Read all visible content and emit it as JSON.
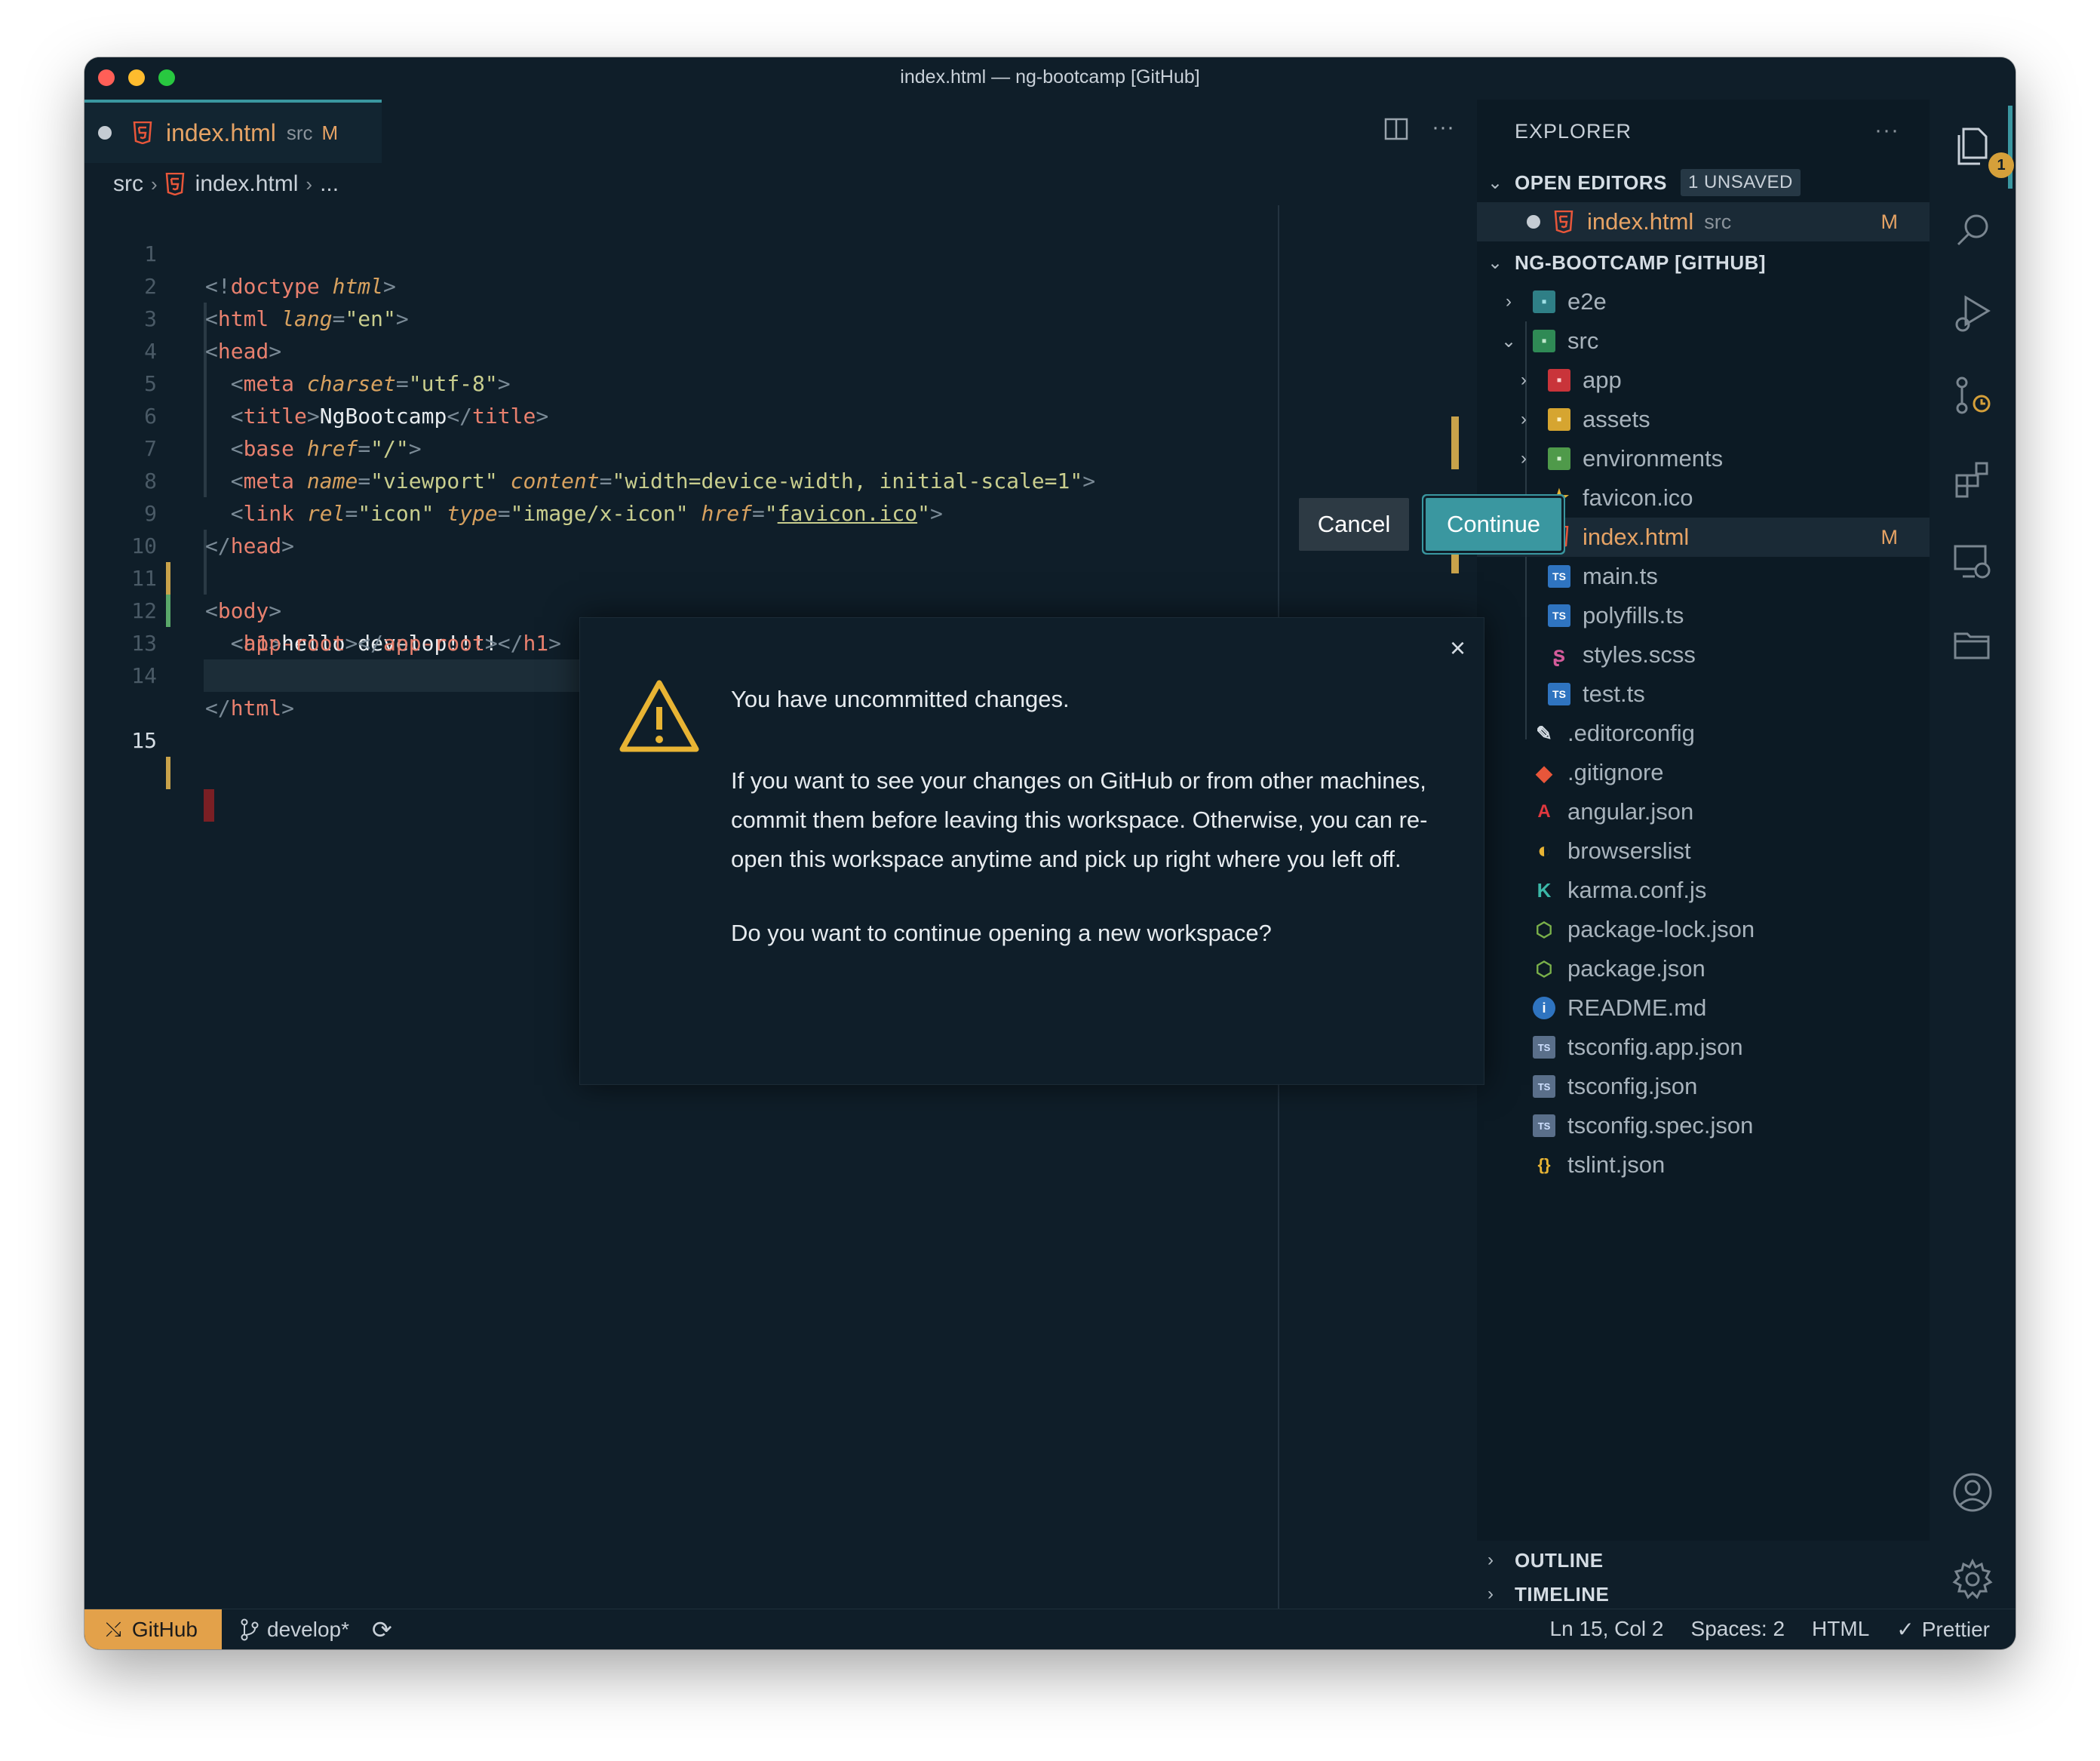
{
  "window": {
    "title": "index.html — ng-bootcamp [GitHub]"
  },
  "tab": {
    "name": "index.html",
    "path": "src",
    "status": "M"
  },
  "breadcrumb": {
    "root": "src",
    "file": "index.html",
    "more": "..."
  },
  "code": {
    "line_numbers": [
      "1",
      "2",
      "3",
      "4",
      "5",
      "6",
      "7",
      "8",
      "9",
      "10",
      "11",
      "12",
      "13",
      "14",
      "15"
    ],
    "active_line": "15"
  },
  "sidebar": {
    "header": "EXPLORER",
    "open_editors": {
      "label": "OPEN EDITORS",
      "badge": "1 UNSAVED",
      "items": [
        {
          "name": "index.html",
          "path": "src",
          "status": "M"
        }
      ]
    },
    "workspace": {
      "label": "NG-BOOTCAMP [GITHUB]",
      "items": [
        {
          "name": "e2e",
          "kind": "folder",
          "icon": "e2e-folder-icon"
        },
        {
          "name": "src",
          "kind": "folder-open",
          "icon": "src-folder-icon"
        },
        {
          "name": "app",
          "kind": "folder",
          "icon": "app-folder-icon"
        },
        {
          "name": "assets",
          "kind": "folder",
          "icon": "assets-folder-icon"
        },
        {
          "name": "environments",
          "kind": "folder",
          "icon": "environments-folder-icon"
        },
        {
          "name": "favicon.ico",
          "kind": "file",
          "icon": "star-icon"
        },
        {
          "name": "index.html",
          "kind": "file",
          "icon": "html5-icon",
          "status": "M"
        },
        {
          "name": "main.ts",
          "kind": "file",
          "icon": "typescript-icon"
        },
        {
          "name": "polyfills.ts",
          "kind": "file",
          "icon": "typescript-icon"
        },
        {
          "name": "styles.scss",
          "kind": "file",
          "icon": "sass-icon"
        },
        {
          "name": "test.ts",
          "kind": "file",
          "icon": "typescript-icon"
        },
        {
          "name": ".editorconfig",
          "kind": "file",
          "icon": "editorconfig-icon"
        },
        {
          "name": ".gitignore",
          "kind": "file",
          "icon": "git-icon"
        },
        {
          "name": "angular.json",
          "kind": "file",
          "icon": "angular-icon"
        },
        {
          "name": "browserslist",
          "kind": "file",
          "icon": "browserslist-icon"
        },
        {
          "name": "karma.conf.js",
          "kind": "file",
          "icon": "karma-icon"
        },
        {
          "name": "package-lock.json",
          "kind": "file",
          "icon": "nodejs-icon"
        },
        {
          "name": "package.json",
          "kind": "file",
          "icon": "nodejs-icon"
        },
        {
          "name": "README.md",
          "kind": "file",
          "icon": "info-icon"
        },
        {
          "name": "tsconfig.app.json",
          "kind": "file",
          "icon": "tsconfig-icon"
        },
        {
          "name": "tsconfig.json",
          "kind": "file",
          "icon": "tsconfig-icon"
        },
        {
          "name": "tsconfig.spec.json",
          "kind": "file",
          "icon": "tsconfig-icon"
        },
        {
          "name": "tslint.json",
          "kind": "file",
          "icon": "json-braces-icon"
        }
      ]
    },
    "outline": "OUTLINE",
    "timeline": "TIMELINE"
  },
  "activity": {
    "explorer_badge": "1"
  },
  "dialog": {
    "title": "You have uncommitted changes.",
    "body": "If you want to see your changes on GitHub or from other machines, commit them before leaving this workspace. Otherwise, you can re-open this workspace anytime and pick up right where you left off.",
    "question": "Do you want to continue opening a new workspace?",
    "cancel": "Cancel",
    "continue": "Continue"
  },
  "statusbar": {
    "remote": "GitHub",
    "branch": "develop*",
    "position": "Ln 15, Col 2",
    "spaces": "Spaces: 2",
    "language": "HTML",
    "formatter": "Prettier"
  },
  "colors": {
    "background": "#0f1e29",
    "accent": "#3a97a0",
    "modified": "#e6a365",
    "status_remote": "#e3a14a"
  }
}
